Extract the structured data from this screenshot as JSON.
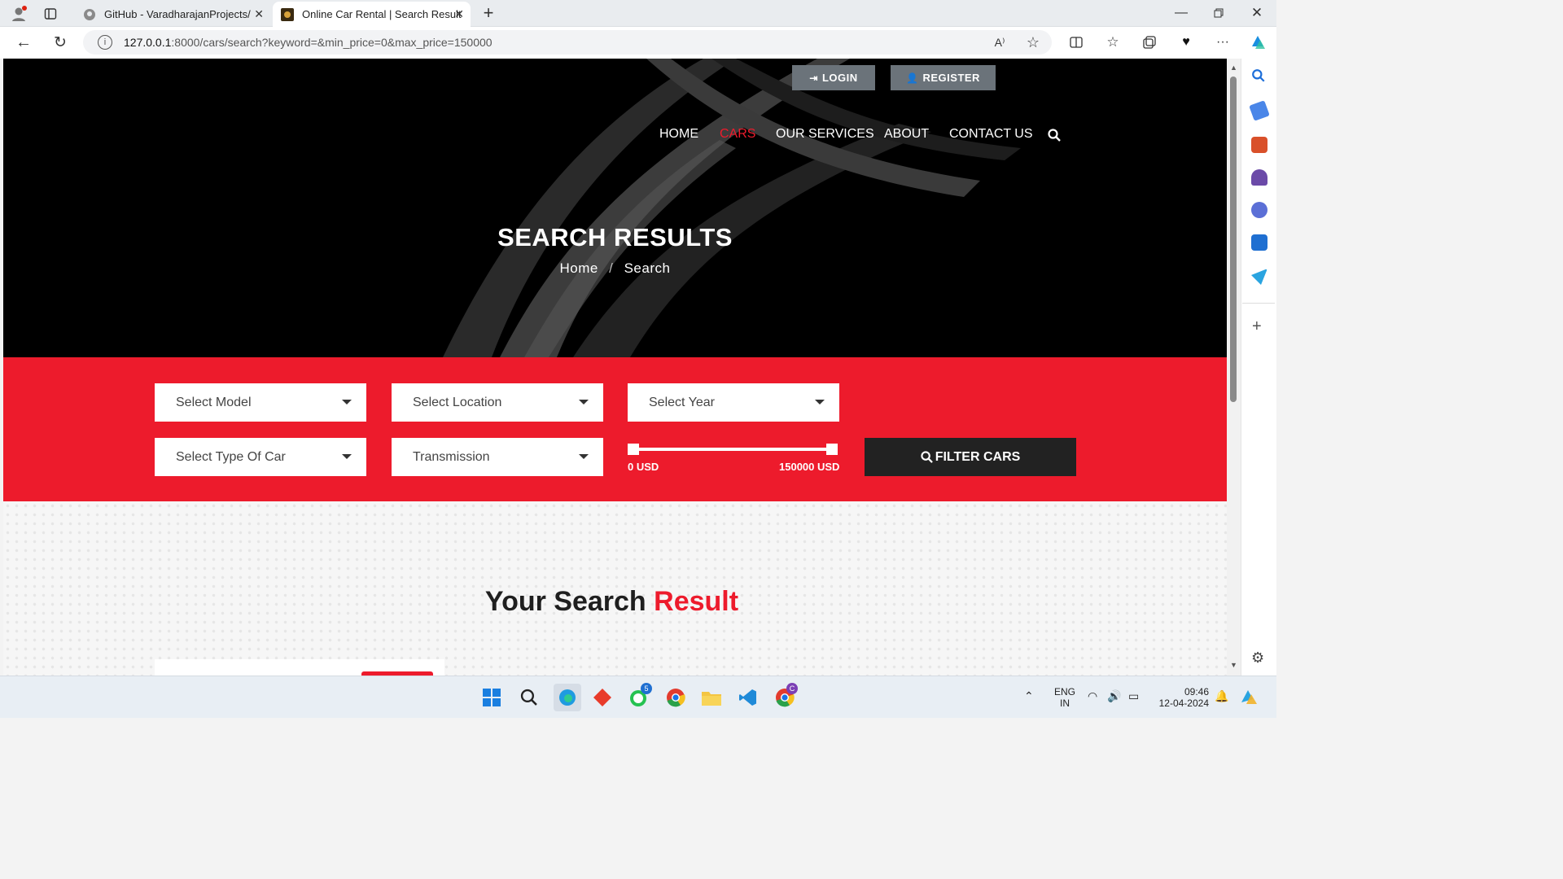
{
  "browser": {
    "tabs": [
      {
        "title": "GitHub - VaradharajanProjects/N",
        "active": false
      },
      {
        "title": "Online Car Rental | Search Result",
        "active": true
      }
    ],
    "url_host": "127.0.0.1",
    "url_rest": ":8000/cars/search?keyword=&min_price=0&max_price=150000"
  },
  "header": {
    "login_label": "LOGIN",
    "register_label": "REGISTER",
    "nav": [
      "HOME",
      "CARS",
      "OUR SERVICES",
      "ABOUT",
      "CONTACT US"
    ],
    "active_nav": "CARS"
  },
  "hero": {
    "title": "SEARCH RESULTS",
    "crumb_home": "Home",
    "crumb_sep": "/",
    "crumb_current": "Search"
  },
  "filters": {
    "model": "Select Model",
    "location": "Select Location",
    "year": "Select Year",
    "type": "Select Type Of Car",
    "transmission": "Transmission",
    "price_min": "0 USD",
    "price_max": "150000 USD",
    "button": "FILTER CARS"
  },
  "results": {
    "title_a": "Your Search",
    "title_b": "Result"
  },
  "taskbar": {
    "lang_a": "ENG",
    "lang_b": "IN",
    "time": "09:46",
    "date": "12-04-2024",
    "whatsapp_badge": "5",
    "chrome_badge": "C"
  },
  "colors": {
    "accent": "#ed1b2c",
    "dark": "#222222"
  }
}
